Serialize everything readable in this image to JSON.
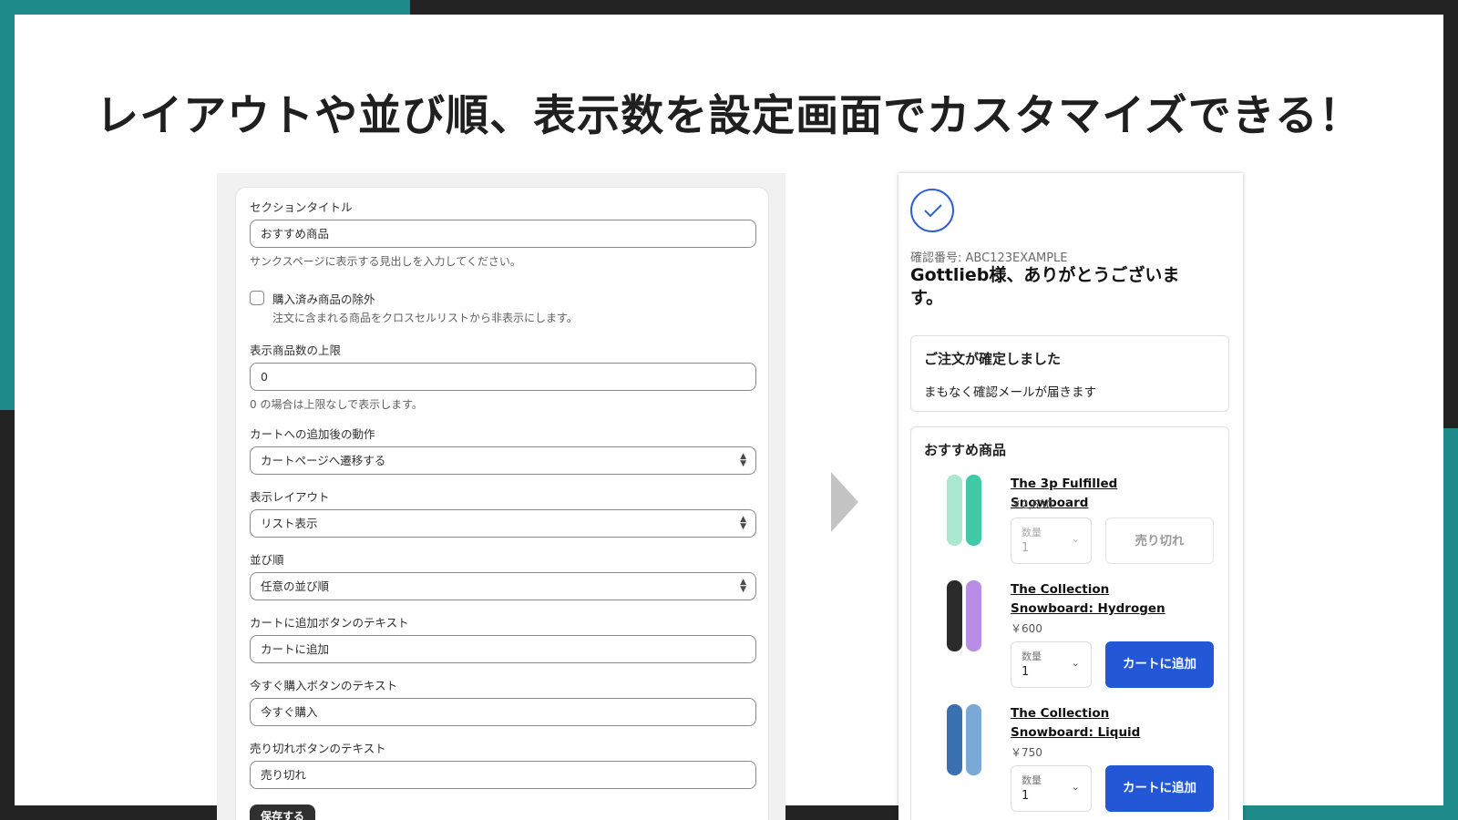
{
  "headline": "レイアウトや並び順、表示数を設定画面でカスタマイズできる！",
  "settings": {
    "section_title": {
      "label": "セクションタイトル",
      "value": "おすすめ商品",
      "help": "サンクスページに表示する見出しを入力してください。"
    },
    "exclude_purchased": {
      "label": "購入済み商品の除外",
      "help": "注文に含まれる商品をクロスセルリストから非表示にします。",
      "checked": false
    },
    "max_products": {
      "label": "表示商品数の上限",
      "value": "0",
      "help": "0 の場合は上限なしで表示します。"
    },
    "after_add_action": {
      "label": "カートへの追加後の動作",
      "value": "カートページへ遷移する"
    },
    "layout": {
      "label": "表示レイアウト",
      "value": "リスト表示"
    },
    "sort_order": {
      "label": "並び順",
      "value": "任意の並び順"
    },
    "add_to_cart_text": {
      "label": "カートに追加ボタンのテキスト",
      "value": "カートに追加"
    },
    "buy_now_text": {
      "label": "今すぐ購入ボタンのテキスト",
      "value": "今すぐ購入"
    },
    "sold_out_text": {
      "label": "売り切れボタンのテキスト",
      "value": "売り切れ"
    },
    "save_label": "保存する"
  },
  "thanks": {
    "confirmation_number": "確認番号: ABC123EXAMPLE",
    "title": "Gottlieb様、ありがとうございます。",
    "order_box": {
      "title": "ご注文が確定しました",
      "text": "まもなく確認メールが届きます"
    },
    "recommend": {
      "title": "おすすめ商品",
      "products": [
        {
          "name": "The 3p Fulfilled Snowboard",
          "price": "￥2,630",
          "qty_label": "数量",
          "qty_value": "1",
          "button": "売り切れ",
          "sold_out": true
        },
        {
          "name": "The Collection Snowboard: Hydrogen",
          "price": "￥600",
          "qty_label": "数量",
          "qty_value": "1",
          "button": "カートに追加",
          "sold_out": false
        },
        {
          "name": "The Collection Snowboard: Liquid",
          "price": "￥750",
          "qty_label": "数量",
          "qty_value": "1",
          "button": "カートに追加",
          "sold_out": false
        }
      ]
    }
  },
  "colors": {
    "teal": "#1f8a8a",
    "dark": "#232323",
    "primary_button": "#2457d6",
    "check_circle": "#2f5fd0"
  }
}
